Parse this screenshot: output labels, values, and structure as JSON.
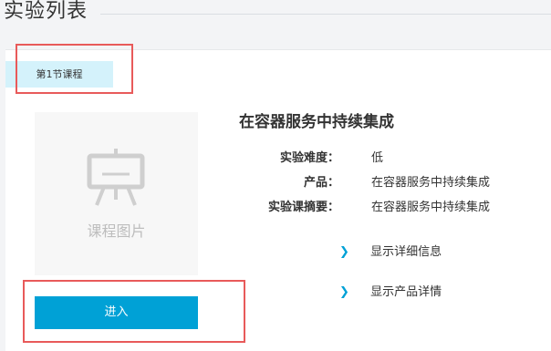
{
  "page": {
    "title": "实验列表"
  },
  "section": {
    "tag_label": "第1节课程"
  },
  "course": {
    "image_caption": "课程图片",
    "title": "在容器服务中持续集成",
    "enter_button_label": "进入",
    "info": [
      {
        "label": "实验难度：",
        "value": "低"
      },
      {
        "label": "产品：",
        "value": "在容器服务中持续集成"
      },
      {
        "label": "实验课摘要：",
        "value": "在容器服务中持续集成"
      }
    ],
    "links": [
      {
        "label": "显示详细信息"
      },
      {
        "label": "显示产品详情"
      }
    ]
  },
  "colors": {
    "accent": "#00a1d6",
    "tag_bg": "#d4f2fb",
    "highlight": "#e85a5a"
  },
  "icons": {
    "placeholder": "easel-icon",
    "link_chevron": "chevron-right-icon"
  }
}
